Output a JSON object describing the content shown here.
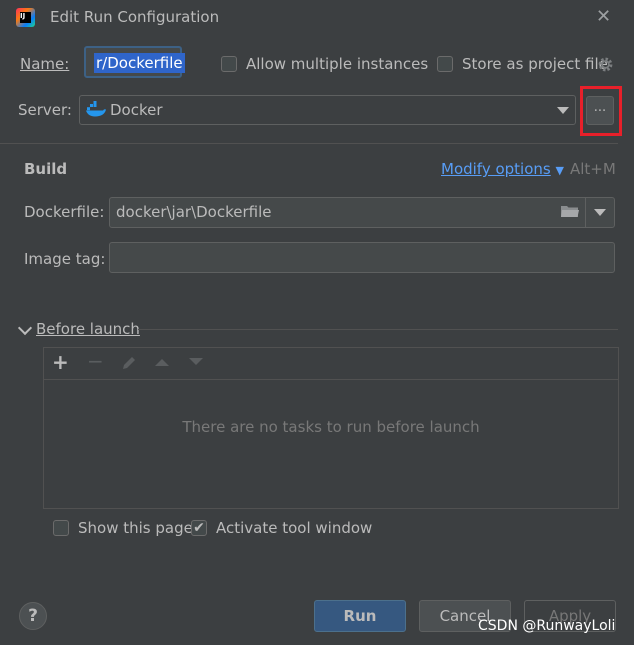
{
  "window": {
    "title": "Edit Run Configuration",
    "close_symbol": "✕"
  },
  "name": {
    "label": "Name:",
    "value": "r/Dockerfile"
  },
  "options": {
    "allow_multiple": "Allow multiple instances",
    "store_as_project_file": "Store as project file"
  },
  "server": {
    "label": "Server:",
    "value": "Docker",
    "browse_label": "..."
  },
  "build": {
    "section_title": "Build",
    "modify_options": "Modify options",
    "modify_shortcut": "Alt+M",
    "dockerfile_label": "Dockerfile:",
    "dockerfile_value": "docker\\jar\\Dockerfile",
    "image_tag_label": "Image tag:",
    "image_tag_value": ""
  },
  "before_launch": {
    "title": "Before launch",
    "empty_message": "There are no tasks to run before launch"
  },
  "footer_options": {
    "show_this_page": "Show this page",
    "activate_tool_window": "Activate tool window",
    "show_this_page_checked": false,
    "activate_tool_window_checked": true
  },
  "buttons": {
    "help": "?",
    "run": "Run",
    "cancel": "Cancel",
    "apply": "Apply"
  },
  "watermark": "CSDN @RunwayLoli",
  "icons": [
    "intellij-app-icon",
    "close-icon",
    "gear-icon",
    "docker-whale-icon",
    "chevron-down-icon",
    "folder-icon",
    "plus-icon",
    "minus-icon",
    "pencil-icon",
    "arrow-up-icon",
    "arrow-down-icon"
  ],
  "colors": {
    "background": "#3c3f41",
    "accent_link": "#589df6",
    "highlight_box": "#e8202a",
    "selection": "#2f65ca",
    "primary_button": "#365880"
  }
}
